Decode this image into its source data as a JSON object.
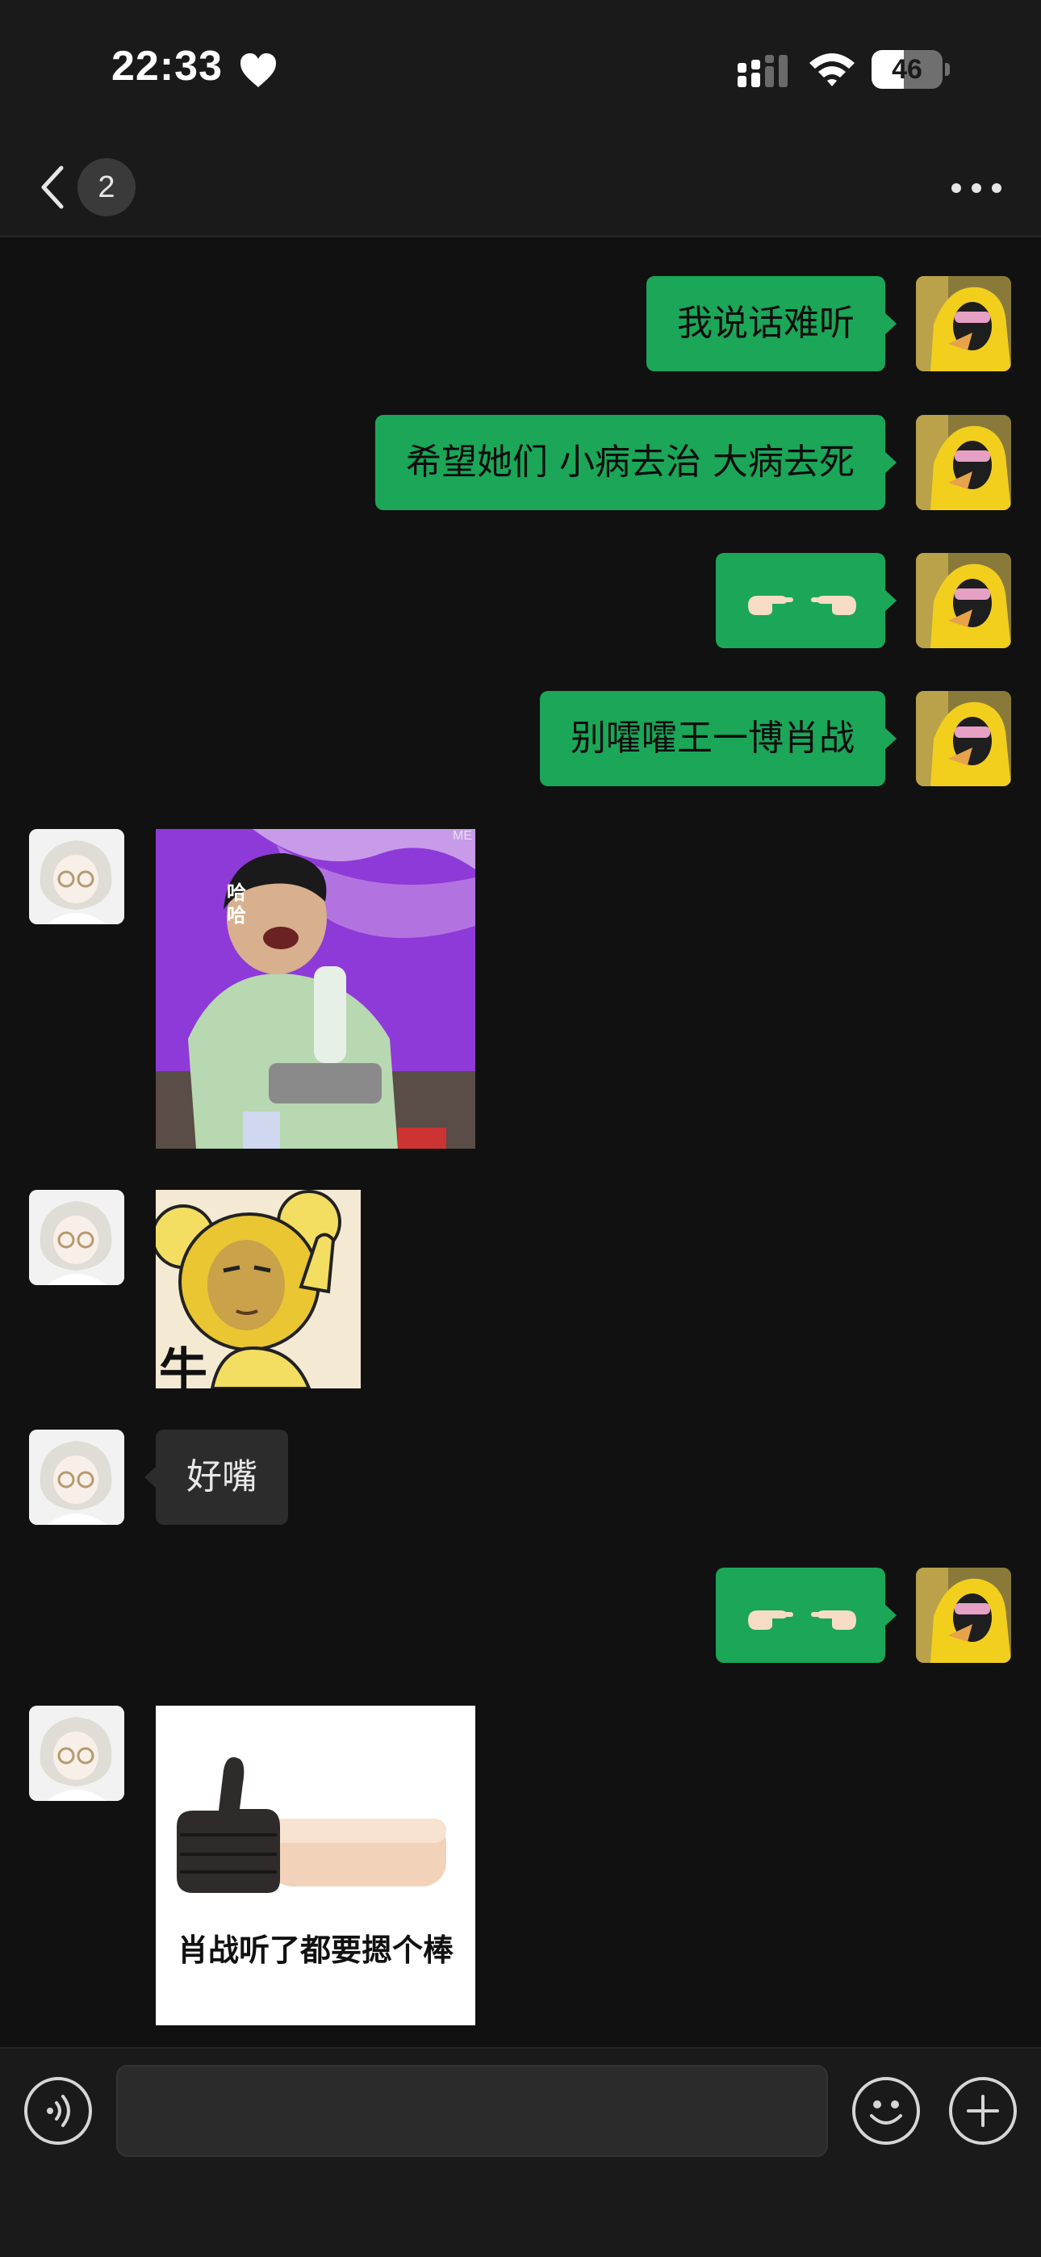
{
  "status_bar": {
    "time": "22:33",
    "battery_level": "46",
    "battery_fraction": 0.46
  },
  "nav": {
    "unread_count": "2"
  },
  "messages": [
    {
      "side": "out",
      "type": "text",
      "text": "我说话难听"
    },
    {
      "side": "out",
      "type": "text",
      "text": "希望她们 小病去治 大病去死"
    },
    {
      "side": "out",
      "type": "emoji",
      "emoji": "pointing-fingers"
    },
    {
      "side": "out",
      "type": "text",
      "text": "别嚯嚯王一博肖战"
    },
    {
      "side": "in",
      "type": "sticker",
      "sticker": "laughing-photo",
      "caption": "哈哈",
      "watermark": "ME"
    },
    {
      "side": "in",
      "type": "sticker",
      "sticker": "cartoon-bear-thumbs",
      "caption": "牛"
    },
    {
      "side": "in",
      "type": "text",
      "text": "好嘴"
    },
    {
      "side": "out",
      "type": "emoji",
      "emoji": "pointing-fingers"
    },
    {
      "side": "in",
      "type": "sticker",
      "sticker": "thumbs-up-arm",
      "caption": "肖战听了都要摁个棒"
    }
  ],
  "input": {
    "value": "",
    "placeholder": ""
  },
  "colors": {
    "background": "#111111",
    "bar": "#1a1a1a",
    "outgoing_bubble": "#1ba658",
    "incoming_bubble": "#2c2c2c"
  }
}
